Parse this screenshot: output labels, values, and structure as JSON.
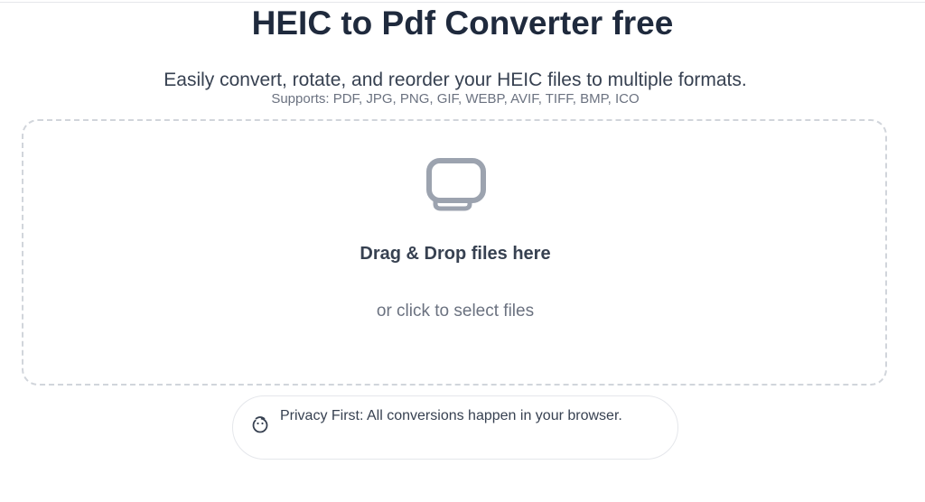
{
  "header": {
    "title": "HEIC to Pdf Converter free",
    "subtitle": "Easily convert, rotate, and reorder your HEIC files to multiple formats.",
    "supports": "Supports: PDF, JPG, PNG, GIF, WEBP, AVIF, TIFF, BMP, ICO"
  },
  "dropzone": {
    "icon": "monitor-upload-icon",
    "title": "Drag & Drop files here",
    "subtitle": "or click to select files"
  },
  "privacy": {
    "icon": "shield-icon",
    "text": "Privacy First: All conversions happen in your browser."
  },
  "colors": {
    "title": "#1f2a3d",
    "text": "#374151",
    "muted": "#6b7280",
    "border": "#d1d5db",
    "icon": "#9ca3af"
  }
}
